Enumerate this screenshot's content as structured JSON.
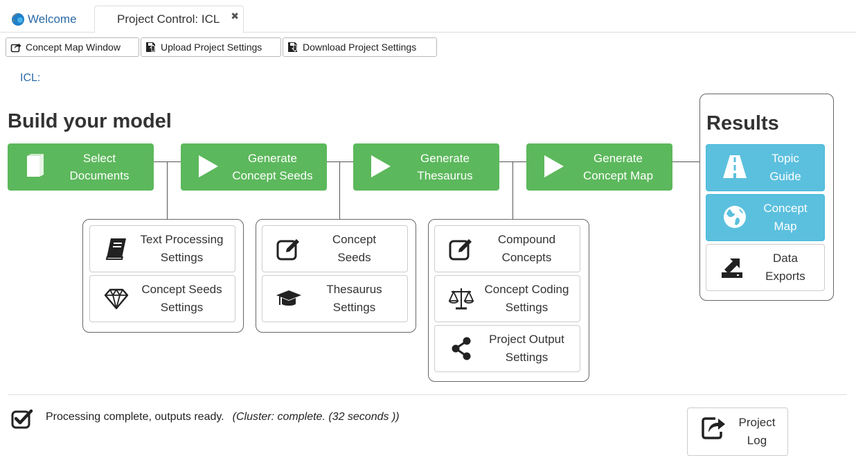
{
  "tabs": {
    "welcome_label": "Welcome",
    "project_label": "Project Control: ICL",
    "close_glyph": "✖"
  },
  "toolbar": {
    "concept_map_window": "Concept Map Window",
    "upload_settings": "Upload Project Settings",
    "download_settings": "Download Project Settings"
  },
  "project": {
    "name": "ICL:"
  },
  "build": {
    "heading": "Build your model",
    "steps": [
      {
        "label": "Select\nDocuments",
        "icon": "document-icon"
      },
      {
        "label": "Generate\nConcept Seeds",
        "icon": "play-icon"
      },
      {
        "label": "Generate\nThesaurus",
        "icon": "play-icon"
      },
      {
        "label": "Generate\nConcept Map",
        "icon": "play-icon"
      }
    ]
  },
  "settings": {
    "text_processing": "Text Processing\nSettings",
    "concept_seeds_settings": "Concept Seeds\nSettings",
    "concept_seeds": "Concept\nSeeds",
    "thesaurus_settings": "Thesaurus\nSettings",
    "compound_concepts": "Compound\nConcepts",
    "concept_coding": "Concept Coding\nSettings",
    "project_output": "Project Output\nSettings"
  },
  "results": {
    "heading": "Results",
    "topic_guide": "Topic\nGuide",
    "concept_map": "Concept\nMap",
    "data_exports": "Data\nExports"
  },
  "status": {
    "message": "Processing complete, outputs ready.",
    "cluster": "(Cluster: complete. (32 seconds ))"
  },
  "log": {
    "label": "Project\nLog"
  },
  "colors": {
    "green": "#5cb85c",
    "blue": "#5bc0de",
    "link": "#2a6aa7"
  }
}
